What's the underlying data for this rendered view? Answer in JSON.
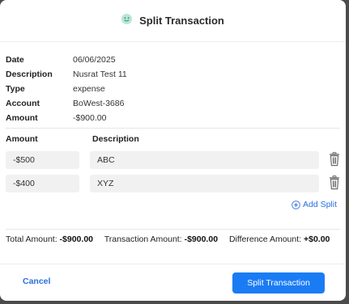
{
  "modal": {
    "title": "Split Transaction",
    "header_icon": "smile-face-icon"
  },
  "transaction": {
    "fields": [
      {
        "label": "Date",
        "value": "06/06/2025"
      },
      {
        "label": "Description",
        "value": "Nusrat Test 11"
      },
      {
        "label": "Type",
        "value": "expense"
      },
      {
        "label": "Account",
        "value": "BoWest-3686"
      },
      {
        "label": "Amount",
        "value": "-$900.00"
      }
    ]
  },
  "splits": {
    "amount_header": "Amount",
    "description_header": "Description",
    "rows": [
      {
        "amount": "-$500",
        "description": "ABC"
      },
      {
        "amount": "-$400",
        "description": "XYZ"
      }
    ],
    "add_label": "Add Split"
  },
  "totals": {
    "total_label": "Total Amount:",
    "total_value": "-$900.00",
    "transaction_label": "Transaction Amount:",
    "transaction_value": "-$900.00",
    "difference_label": "Difference Amount:",
    "difference_value": "+$0.00"
  },
  "footer": {
    "cancel_label": "Cancel",
    "submit_label": "Split Transaction"
  },
  "colors": {
    "accent": "#1a7cf5",
    "link": "#2a6fdb"
  }
}
